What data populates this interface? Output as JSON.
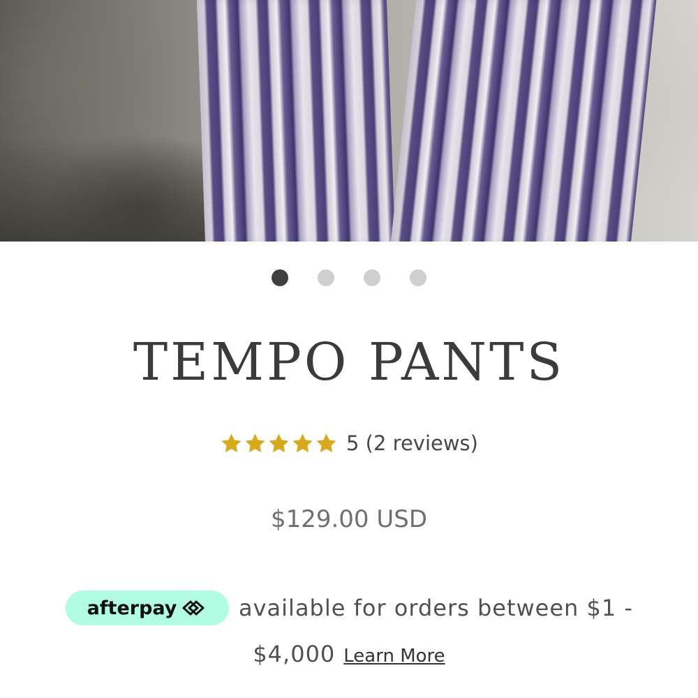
{
  "product": {
    "image_alt": "Purple tie-dye striped pants",
    "carousel": {
      "count": 4,
      "active_index": 0
    },
    "title": "TEMPO PANTS",
    "rating": {
      "stars": 5,
      "max_stars": 5,
      "text": "5 (2 reviews)"
    },
    "price": "$129.00 USD"
  },
  "afterpay": {
    "brand": "afterpay",
    "icon": "afterpay-arrows-icon",
    "text_line1": "available for orders between $1 -",
    "text_line2": "$4,000",
    "learn_more": "Learn More",
    "badge_color": "#b2fce4"
  },
  "colors": {
    "star": "#d7a91c",
    "title": "#3b3b3b",
    "dot_active": "#3f3f3f",
    "dot_inactive": "#cfcfcf"
  }
}
